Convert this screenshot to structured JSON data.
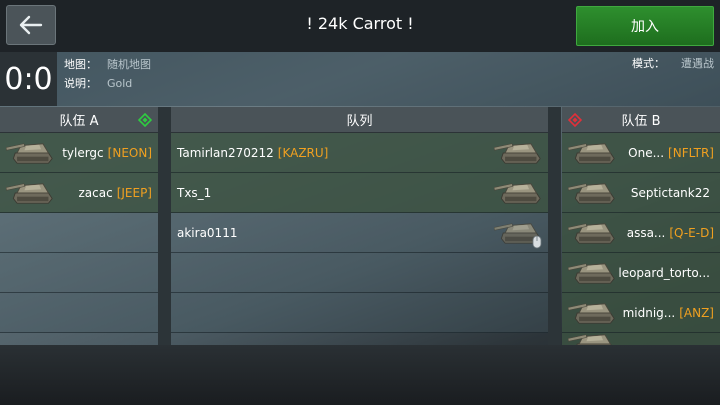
{
  "header": {
    "title": "! 24k Carrot !",
    "join_label": "加入",
    "back_icon": "arrow-left-icon"
  },
  "info": {
    "score": "0:0",
    "map_label": "地图：",
    "map_value": "随机地图",
    "desc_label": "说明：",
    "desc_value": "Gold",
    "mode_label": "模式：",
    "mode_value": "遭遇战"
  },
  "team_a": {
    "title": "队伍 A",
    "color": "#2ecc40",
    "players": [
      {
        "name": "tylergc",
        "tag": "[NEON]"
      },
      {
        "name": "zacac",
        "tag": "[JEEP]"
      }
    ]
  },
  "queue": {
    "title": "队列",
    "players": [
      {
        "name": "Tamirlan270212",
        "tag": "[KAZRU]"
      },
      {
        "name": "Txs_1",
        "tag": ""
      },
      {
        "name": "akira0111",
        "tag": ""
      }
    ]
  },
  "team_b": {
    "title": "队伍 B",
    "color": "#e0303a",
    "players": [
      {
        "name": "One...",
        "tag": "[NFLTR]"
      },
      {
        "name": "Septictank22",
        "tag": ""
      },
      {
        "name": "assa...",
        "tag": "[Q-E-D]"
      },
      {
        "name": "leopard_torto...",
        "tag": ""
      },
      {
        "name": "midnig...",
        "tag": "[ANZ]"
      }
    ]
  }
}
